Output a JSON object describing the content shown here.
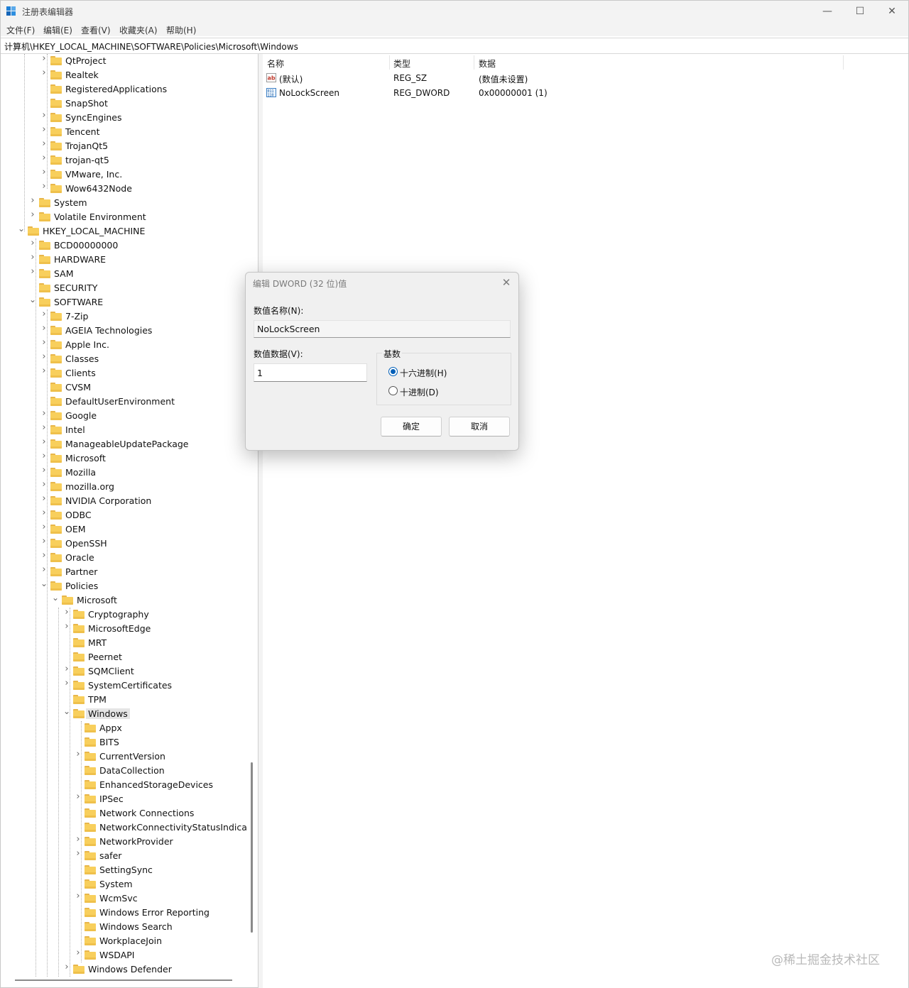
{
  "window": {
    "title": "注册表编辑器",
    "minimize": "—",
    "maximize": "☐",
    "close": "✕"
  },
  "menu": [
    "文件(F)",
    "编辑(E)",
    "查看(V)",
    "收藏夹(A)",
    "帮助(H)"
  ],
  "address": "计算机\\HKEY_LOCAL_MACHINE\\SOFTWARE\\Policies\\Microsoft\\Windows",
  "tree": [
    {
      "label": "QtProject",
      "depth": 3,
      "expandable": true
    },
    {
      "label": "Realtek",
      "depth": 3,
      "expandable": true
    },
    {
      "label": "RegisteredApplications",
      "depth": 3,
      "expandable": false
    },
    {
      "label": "SnapShot",
      "depth": 3,
      "expandable": false
    },
    {
      "label": "SyncEngines",
      "depth": 3,
      "expandable": true
    },
    {
      "label": "Tencent",
      "depth": 3,
      "expandable": true
    },
    {
      "label": "TrojanQt5",
      "depth": 3,
      "expandable": true
    },
    {
      "label": "trojan-qt5",
      "depth": 3,
      "expandable": true
    },
    {
      "label": "VMware, Inc.",
      "depth": 3,
      "expandable": true
    },
    {
      "label": "Wow6432Node",
      "depth": 3,
      "expandable": true
    },
    {
      "label": "System",
      "depth": 2,
      "expandable": true
    },
    {
      "label": "Volatile Environment",
      "depth": 2,
      "expandable": true
    },
    {
      "label": "HKEY_LOCAL_MACHINE",
      "depth": 1,
      "expandable": true,
      "expanded": true
    },
    {
      "label": "BCD00000000",
      "depth": 2,
      "expandable": true
    },
    {
      "label": "HARDWARE",
      "depth": 2,
      "expandable": true
    },
    {
      "label": "SAM",
      "depth": 2,
      "expandable": true
    },
    {
      "label": "SECURITY",
      "depth": 2,
      "expandable": false
    },
    {
      "label": "SOFTWARE",
      "depth": 2,
      "expandable": true,
      "expanded": true
    },
    {
      "label": "7-Zip",
      "depth": 3,
      "expandable": true
    },
    {
      "label": "AGEIA Technologies",
      "depth": 3,
      "expandable": true
    },
    {
      "label": "Apple Inc.",
      "depth": 3,
      "expandable": true
    },
    {
      "label": "Classes",
      "depth": 3,
      "expandable": true
    },
    {
      "label": "Clients",
      "depth": 3,
      "expandable": true
    },
    {
      "label": "CVSM",
      "depth": 3,
      "expandable": false
    },
    {
      "label": "DefaultUserEnvironment",
      "depth": 3,
      "expandable": false
    },
    {
      "label": "Google",
      "depth": 3,
      "expandable": true
    },
    {
      "label": "Intel",
      "depth": 3,
      "expandable": true
    },
    {
      "label": "ManageableUpdatePackage",
      "depth": 3,
      "expandable": true
    },
    {
      "label": "Microsoft",
      "depth": 3,
      "expandable": true
    },
    {
      "label": "Mozilla",
      "depth": 3,
      "expandable": true
    },
    {
      "label": "mozilla.org",
      "depth": 3,
      "expandable": true
    },
    {
      "label": "NVIDIA Corporation",
      "depth": 3,
      "expandable": true
    },
    {
      "label": "ODBC",
      "depth": 3,
      "expandable": true
    },
    {
      "label": "OEM",
      "depth": 3,
      "expandable": true
    },
    {
      "label": "OpenSSH",
      "depth": 3,
      "expandable": true
    },
    {
      "label": "Oracle",
      "depth": 3,
      "expandable": true
    },
    {
      "label": "Partner",
      "depth": 3,
      "expandable": true
    },
    {
      "label": "Policies",
      "depth": 3,
      "expandable": true,
      "expanded": true
    },
    {
      "label": "Microsoft",
      "depth": 4,
      "expandable": true,
      "expanded": true
    },
    {
      "label": "Cryptography",
      "depth": 5,
      "expandable": true
    },
    {
      "label": "MicrosoftEdge",
      "depth": 5,
      "expandable": true
    },
    {
      "label": "MRT",
      "depth": 5,
      "expandable": false
    },
    {
      "label": "Peernet",
      "depth": 5,
      "expandable": false
    },
    {
      "label": "SQMClient",
      "depth": 5,
      "expandable": true
    },
    {
      "label": "SystemCertificates",
      "depth": 5,
      "expandable": true
    },
    {
      "label": "TPM",
      "depth": 5,
      "expandable": false
    },
    {
      "label": "Windows",
      "depth": 5,
      "expandable": true,
      "expanded": true,
      "selected": true
    },
    {
      "label": "Appx",
      "depth": 6,
      "expandable": false
    },
    {
      "label": "BITS",
      "depth": 6,
      "expandable": false
    },
    {
      "label": "CurrentVersion",
      "depth": 6,
      "expandable": true
    },
    {
      "label": "DataCollection",
      "depth": 6,
      "expandable": false
    },
    {
      "label": "EnhancedStorageDevices",
      "depth": 6,
      "expandable": false
    },
    {
      "label": "IPSec",
      "depth": 6,
      "expandable": true
    },
    {
      "label": "Network Connections",
      "depth": 6,
      "expandable": false
    },
    {
      "label": "NetworkConnectivityStatusIndicator",
      "depth": 6,
      "expandable": false
    },
    {
      "label": "NetworkProvider",
      "depth": 6,
      "expandable": true
    },
    {
      "label": "safer",
      "depth": 6,
      "expandable": true
    },
    {
      "label": "SettingSync",
      "depth": 6,
      "expandable": false
    },
    {
      "label": "System",
      "depth": 6,
      "expandable": false
    },
    {
      "label": "WcmSvc",
      "depth": 6,
      "expandable": true
    },
    {
      "label": "Windows Error Reporting",
      "depth": 6,
      "expandable": false
    },
    {
      "label": "Windows Search",
      "depth": 6,
      "expandable": false
    },
    {
      "label": "WorkplaceJoin",
      "depth": 6,
      "expandable": false
    },
    {
      "label": "WSDAPI",
      "depth": 6,
      "expandable": true
    },
    {
      "label": "Windows Defender",
      "depth": 5,
      "expandable": true
    }
  ],
  "list": {
    "columns": [
      "名称",
      "类型",
      "数据"
    ],
    "rows": [
      {
        "name": "(默认)",
        "type": "REG_SZ",
        "data": "(数值未设置)",
        "icon": "string-value-icon"
      },
      {
        "name": "NoLockScreen",
        "type": "REG_DWORD",
        "data": "0x00000001 (1)",
        "icon": "dword-value-icon"
      }
    ]
  },
  "dialog": {
    "title": "编辑 DWORD (32 位)值",
    "close": "✕",
    "name_label": "数值名称(N):",
    "name_value": "NoLockScreen",
    "data_label": "数值数据(V):",
    "data_value": "1",
    "base_label": "基数",
    "radio_hex": "十六进制(H)",
    "radio_dec": "十进制(D)",
    "selected_base": "hex",
    "ok": "确定",
    "cancel": "取消"
  },
  "watermark": "@稀土掘金技术社区"
}
